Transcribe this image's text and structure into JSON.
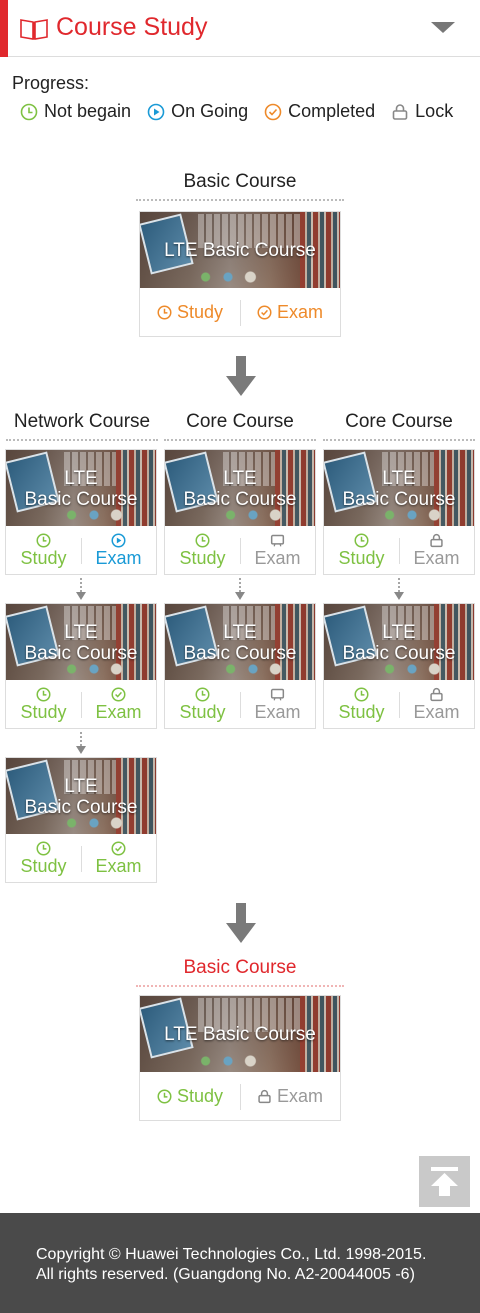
{
  "header": {
    "title": "Course Study",
    "icon": "book-icon",
    "menu_icon": "chevron-down-icon"
  },
  "legend": {
    "title": "Progress:",
    "items": [
      {
        "label": "Not begain",
        "icon": "clock-icon",
        "color": "#7ec142"
      },
      {
        "label": "On Going",
        "icon": "play-icon",
        "color": "#1a9ad6"
      },
      {
        "label": "Completed",
        "icon": "check-icon",
        "color": "#ee8a2a"
      },
      {
        "label": "Lock",
        "icon": "lock-icon",
        "color": "#888888"
      }
    ]
  },
  "top": {
    "title": "Basic Course",
    "card": {
      "image_label": "LTE Basic Course",
      "study": "Study",
      "exam": "Exam"
    }
  },
  "columns": [
    {
      "title": "Network Course"
    },
    {
      "title": "Core Course"
    },
    {
      "title": "Core Course"
    }
  ],
  "grid": [
    [
      {
        "line1": "LTE",
        "line2": "Basic Course",
        "study": "Study",
        "exam": "Exam"
      },
      {
        "line1": "LTE",
        "line2": "Basic Course",
        "study": "Study",
        "exam": "Exam"
      },
      {
        "line1": "LTE",
        "line2": "Basic Course",
        "study": "Study",
        "exam": "Exam"
      }
    ],
    [
      {
        "line1": "LTE",
        "line2": "Basic Course",
        "study": "Study",
        "exam": "Exam"
      },
      {
        "line1": "LTE",
        "line2": "Basic Course",
        "study": "Study",
        "exam": "Exam"
      },
      {
        "line1": "LTE",
        "line2": "Basic Course",
        "study": "Study",
        "exam": "Exam"
      }
    ],
    [
      {
        "line1": "LTE",
        "line2": "Basic Course",
        "study": "Study",
        "exam": "Exam"
      }
    ]
  ],
  "bottom": {
    "title": "Basic Course",
    "card": {
      "image_label": "LTE Basic Course",
      "study": "Study",
      "exam": "Exam"
    }
  },
  "back_to_top_icon": "arrow-up-to-top-icon",
  "footer": {
    "line1": "Copyright © Huawei Technologies Co., Ltd. 1998-2015.",
    "line2": "All rights reserved. (Guangdong No. A2-20044005 -6)"
  }
}
